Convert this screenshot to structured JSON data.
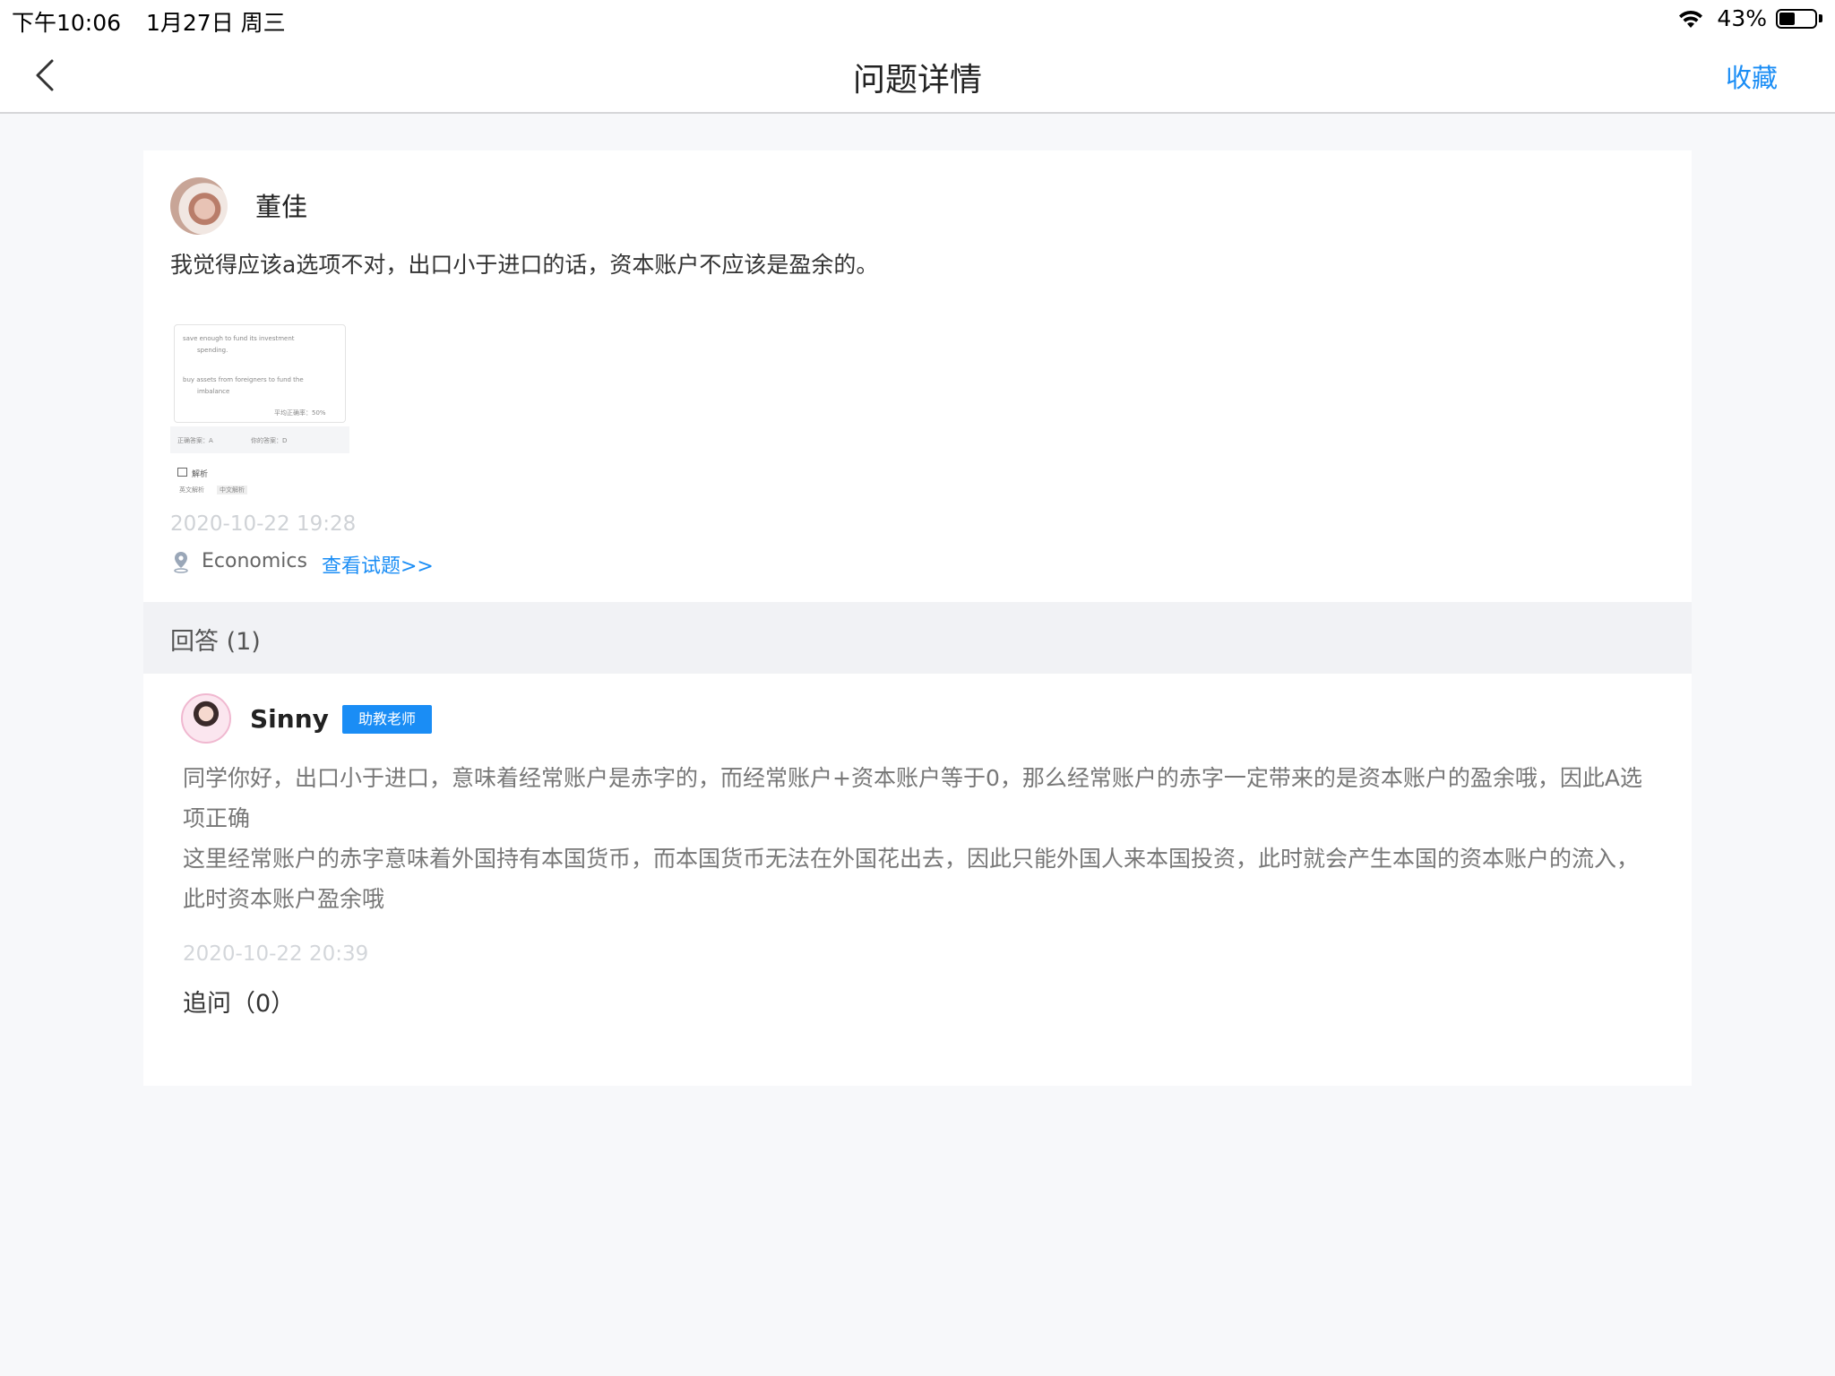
{
  "status_bar": {
    "time": "下午10:06",
    "date": "1月27日 周三",
    "battery": "43%"
  },
  "nav": {
    "title": "问题详情",
    "favorite_label": "收藏"
  },
  "question": {
    "author": "董佳",
    "text": "我觉得应该a选项不对，出口小于进口的话，资本账户不应该是盈余的。",
    "thumbnail": {
      "line_b": "save enough to fund its investment",
      "line_b2": "spending.",
      "line_c": "buy assets from foreigners to fund the",
      "line_c2": "imbalance",
      "accuracy": "平均正确率：50%",
      "correct": "正确答案：A",
      "yours": "你的答案：D",
      "explain": "解析",
      "en": "英文解析",
      "cn": "中文解析"
    },
    "time": "2020-10-22 19:28",
    "subject": "Economics",
    "view_link": "查看试题>>"
  },
  "answers": {
    "header": "回答 (1)",
    "items": [
      {
        "author": "Sinny",
        "badge": "助教老师",
        "body_1": "同学你好，出口小于进口，意味着经常账户是赤字的，而经常账户+资本账户等于0，那么经常账户的赤字一定带来的是资本账户的盈余哦，因此A选项正确",
        "body_2": "这里经常账户的赤字意味着外国持有本国货币，而本国货币无法在外国花出去，因此只能外国人来本国投资，此时就会产生本国的资本账户的流入，此时资本账户盈余哦",
        "time": "2020-10-22 20:39",
        "followup": "追问（0）"
      }
    ]
  },
  "colors": {
    "accent": "#1a8df5",
    "background": "#f7f8fa",
    "section_header": "#f1f2f5"
  }
}
